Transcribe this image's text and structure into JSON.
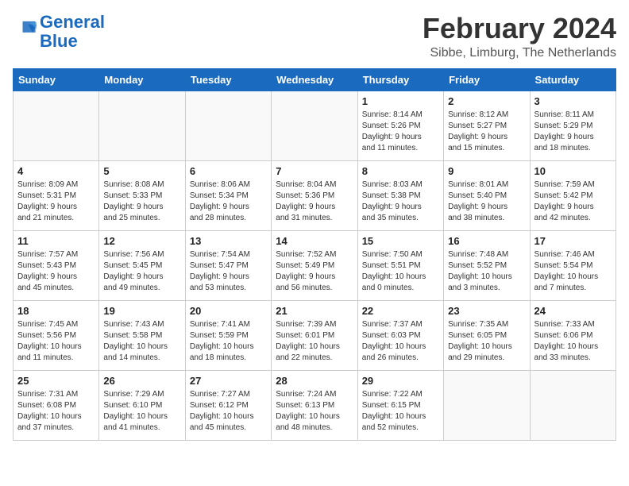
{
  "header": {
    "logo_line1": "General",
    "logo_line2": "Blue",
    "month_year": "February 2024",
    "location": "Sibbe, Limburg, The Netherlands"
  },
  "weekdays": [
    "Sunday",
    "Monday",
    "Tuesday",
    "Wednesday",
    "Thursday",
    "Friday",
    "Saturday"
  ],
  "weeks": [
    [
      {
        "day": "",
        "info": ""
      },
      {
        "day": "",
        "info": ""
      },
      {
        "day": "",
        "info": ""
      },
      {
        "day": "",
        "info": ""
      },
      {
        "day": "1",
        "info": "Sunrise: 8:14 AM\nSunset: 5:26 PM\nDaylight: 9 hours\nand 11 minutes."
      },
      {
        "day": "2",
        "info": "Sunrise: 8:12 AM\nSunset: 5:27 PM\nDaylight: 9 hours\nand 15 minutes."
      },
      {
        "day": "3",
        "info": "Sunrise: 8:11 AM\nSunset: 5:29 PM\nDaylight: 9 hours\nand 18 minutes."
      }
    ],
    [
      {
        "day": "4",
        "info": "Sunrise: 8:09 AM\nSunset: 5:31 PM\nDaylight: 9 hours\nand 21 minutes."
      },
      {
        "day": "5",
        "info": "Sunrise: 8:08 AM\nSunset: 5:33 PM\nDaylight: 9 hours\nand 25 minutes."
      },
      {
        "day": "6",
        "info": "Sunrise: 8:06 AM\nSunset: 5:34 PM\nDaylight: 9 hours\nand 28 minutes."
      },
      {
        "day": "7",
        "info": "Sunrise: 8:04 AM\nSunset: 5:36 PM\nDaylight: 9 hours\nand 31 minutes."
      },
      {
        "day": "8",
        "info": "Sunrise: 8:03 AM\nSunset: 5:38 PM\nDaylight: 9 hours\nand 35 minutes."
      },
      {
        "day": "9",
        "info": "Sunrise: 8:01 AM\nSunset: 5:40 PM\nDaylight: 9 hours\nand 38 minutes."
      },
      {
        "day": "10",
        "info": "Sunrise: 7:59 AM\nSunset: 5:42 PM\nDaylight: 9 hours\nand 42 minutes."
      }
    ],
    [
      {
        "day": "11",
        "info": "Sunrise: 7:57 AM\nSunset: 5:43 PM\nDaylight: 9 hours\nand 45 minutes."
      },
      {
        "day": "12",
        "info": "Sunrise: 7:56 AM\nSunset: 5:45 PM\nDaylight: 9 hours\nand 49 minutes."
      },
      {
        "day": "13",
        "info": "Sunrise: 7:54 AM\nSunset: 5:47 PM\nDaylight: 9 hours\nand 53 minutes."
      },
      {
        "day": "14",
        "info": "Sunrise: 7:52 AM\nSunset: 5:49 PM\nDaylight: 9 hours\nand 56 minutes."
      },
      {
        "day": "15",
        "info": "Sunrise: 7:50 AM\nSunset: 5:51 PM\nDaylight: 10 hours\nand 0 minutes."
      },
      {
        "day": "16",
        "info": "Sunrise: 7:48 AM\nSunset: 5:52 PM\nDaylight: 10 hours\nand 3 minutes."
      },
      {
        "day": "17",
        "info": "Sunrise: 7:46 AM\nSunset: 5:54 PM\nDaylight: 10 hours\nand 7 minutes."
      }
    ],
    [
      {
        "day": "18",
        "info": "Sunrise: 7:45 AM\nSunset: 5:56 PM\nDaylight: 10 hours\nand 11 minutes."
      },
      {
        "day": "19",
        "info": "Sunrise: 7:43 AM\nSunset: 5:58 PM\nDaylight: 10 hours\nand 14 minutes."
      },
      {
        "day": "20",
        "info": "Sunrise: 7:41 AM\nSunset: 5:59 PM\nDaylight: 10 hours\nand 18 minutes."
      },
      {
        "day": "21",
        "info": "Sunrise: 7:39 AM\nSunset: 6:01 PM\nDaylight: 10 hours\nand 22 minutes."
      },
      {
        "day": "22",
        "info": "Sunrise: 7:37 AM\nSunset: 6:03 PM\nDaylight: 10 hours\nand 26 minutes."
      },
      {
        "day": "23",
        "info": "Sunrise: 7:35 AM\nSunset: 6:05 PM\nDaylight: 10 hours\nand 29 minutes."
      },
      {
        "day": "24",
        "info": "Sunrise: 7:33 AM\nSunset: 6:06 PM\nDaylight: 10 hours\nand 33 minutes."
      }
    ],
    [
      {
        "day": "25",
        "info": "Sunrise: 7:31 AM\nSunset: 6:08 PM\nDaylight: 10 hours\nand 37 minutes."
      },
      {
        "day": "26",
        "info": "Sunrise: 7:29 AM\nSunset: 6:10 PM\nDaylight: 10 hours\nand 41 minutes."
      },
      {
        "day": "27",
        "info": "Sunrise: 7:27 AM\nSunset: 6:12 PM\nDaylight: 10 hours\nand 45 minutes."
      },
      {
        "day": "28",
        "info": "Sunrise: 7:24 AM\nSunset: 6:13 PM\nDaylight: 10 hours\nand 48 minutes."
      },
      {
        "day": "29",
        "info": "Sunrise: 7:22 AM\nSunset: 6:15 PM\nDaylight: 10 hours\nand 52 minutes."
      },
      {
        "day": "",
        "info": ""
      },
      {
        "day": "",
        "info": ""
      }
    ]
  ]
}
